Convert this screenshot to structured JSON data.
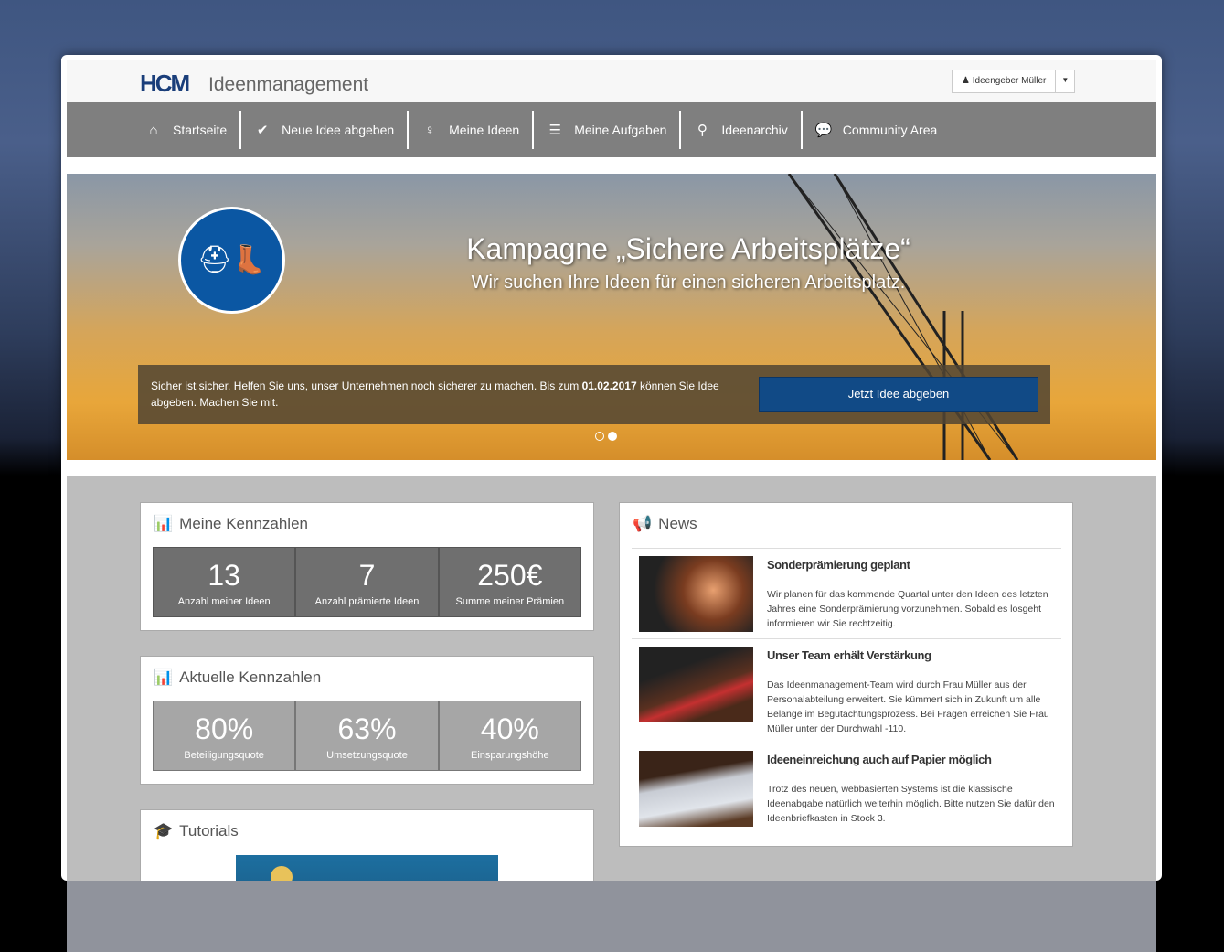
{
  "header": {
    "logo": "HCM",
    "app_title": "Ideenmanagement",
    "user_label": "Ideengeber Müller"
  },
  "nav": [
    {
      "icon": "home-icon",
      "glyph": "⌂",
      "label": "Startseite"
    },
    {
      "icon": "check-icon",
      "glyph": "✔",
      "label": "Neue Idee abgeben"
    },
    {
      "icon": "lightbulb-icon",
      "glyph": "♀",
      "label": "Meine Ideen"
    },
    {
      "icon": "list-icon",
      "glyph": "☰",
      "label": "Meine Aufgaben"
    },
    {
      "icon": "search-icon",
      "glyph": "⚲",
      "label": "Ideenarchiv"
    },
    {
      "icon": "comments-icon",
      "glyph": "💬",
      "label": "Community Area"
    }
  ],
  "banner": {
    "title": "Kampagne „Sichere Arbeitsplätze“",
    "subtitle": "Wir suchen Ihre Ideen für einen sicheren Arbeitsplatz.",
    "caption_pre": "Sicher ist sicher. Helfen Sie uns, unser Unternehmen noch sicherer zu machen. Bis zum ",
    "caption_date": "01.02.2017",
    "caption_post": " können Sie Idee abgeben. Machen Sie mit.",
    "cta": "Jetzt Idee abgeben",
    "slides": 2,
    "active_slide": 2
  },
  "my_stats": {
    "title": "Meine Kennzahlen",
    "items": [
      {
        "value": "13",
        "label": "Anzahl meiner Ideen"
      },
      {
        "value": "7",
        "label": "Anzahl prämierte Ideen"
      },
      {
        "value": "250€",
        "label": "Summe meiner Prämien"
      }
    ]
  },
  "current_stats": {
    "title": "Aktuelle Kennzahlen",
    "items": [
      {
        "value": "80%",
        "label": "Beteiligungsquote"
      },
      {
        "value": "63%",
        "label": "Umsetzungsquote"
      },
      {
        "value": "40%",
        "label": "Einsparungshöhe"
      }
    ]
  },
  "tutorials": {
    "title": "Tutorials"
  },
  "news": {
    "title": "News",
    "items": [
      {
        "title": "Sonderprämierung geplant",
        "body": "Wir planen für das kommende Quartal unter den Ideen des letzten Jahres eine Sonderprämierung vorzunehmen. Sobald es losgeht informieren wir Sie rechtzeitig."
      },
      {
        "title": "Unser Team erhält Verstärkung",
        "body": "Das Ideenmanagement-Team wird durch Frau Müller aus der Personalabteilung erweitert. Sie kümmert sich in Zukunft um alle Belange im Begutachtungsprozess. Bei Fragen erreichen Sie Frau Müller unter der Durchwahl -110."
      },
      {
        "title": "Ideeneinreichung auch auf Papier möglich",
        "body": "Trotz des neuen, webbasierten Systems ist die klassische Ideenabgabe natürlich weiterhin möglich. Bitte nutzen Sie dafür den Ideenbriefkasten in Stock 3."
      }
    ]
  }
}
